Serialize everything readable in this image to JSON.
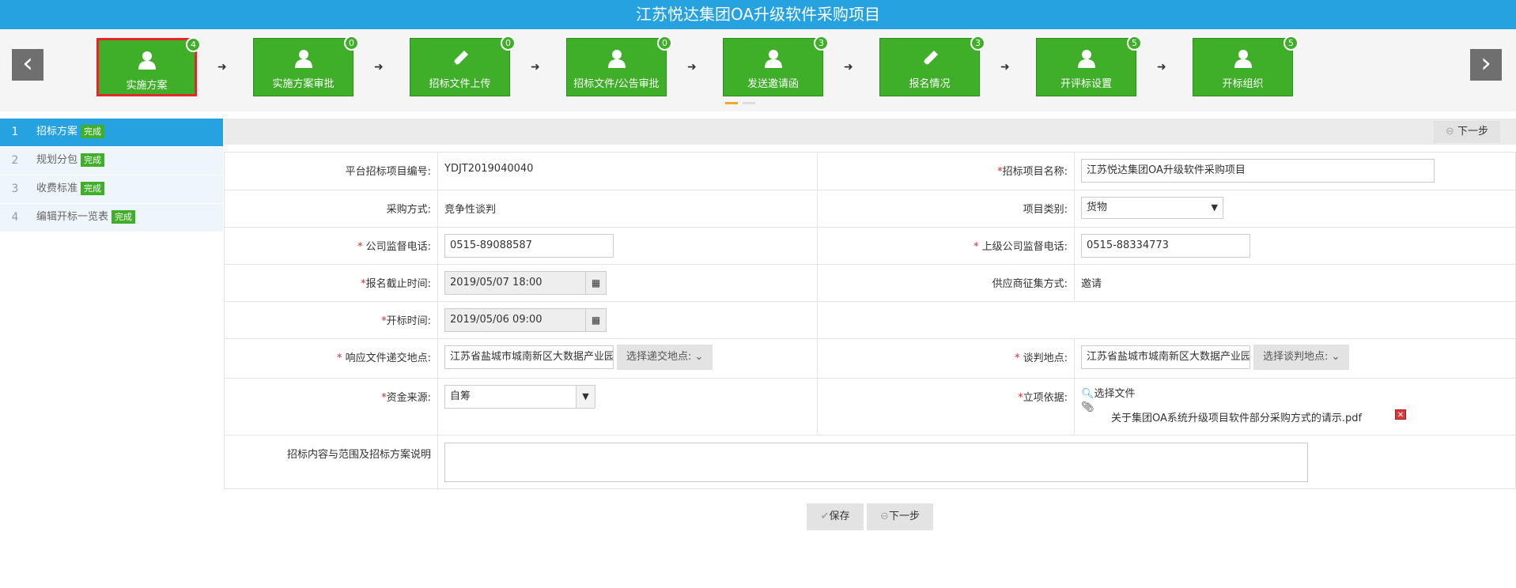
{
  "title": "江苏悦达集团OA升级软件采购项目",
  "steps": [
    {
      "label": "实施方案",
      "count": "4",
      "icon": "user"
    },
    {
      "label": "实施方案审批",
      "count": "0",
      "icon": "user"
    },
    {
      "label": "招标文件上传",
      "count": "0",
      "icon": "pencil"
    },
    {
      "label": "招标文件/公告审批",
      "count": "0",
      "icon": "user"
    },
    {
      "label": "发送邀请函",
      "count": "3",
      "icon": "user"
    },
    {
      "label": "报名情况",
      "count": "3",
      "icon": "pencil"
    },
    {
      "label": "开评标设置",
      "count": "5",
      "icon": "user"
    },
    {
      "label": "开标组织",
      "count": "5",
      "icon": "user"
    }
  ],
  "nav_prev": "‹",
  "nav_next": "›",
  "sidebar": [
    {
      "num": "1",
      "label": "招标方案",
      "status": "完成"
    },
    {
      "num": "2",
      "label": "规划分包",
      "status": "完成"
    },
    {
      "num": "3",
      "label": "收费标准",
      "status": "完成"
    },
    {
      "num": "4",
      "label": "编辑开标一览表",
      "status": "完成"
    }
  ],
  "next_step_label": "下一步",
  "form": {
    "project_no_label": "平台招标项目编号:",
    "project_no": "YDJT2019040040",
    "project_name_label": "招标项目名称:",
    "project_name": "江苏悦达集团OA升级软件采购项目",
    "purchase_method_label": "采购方式:",
    "purchase_method": "竞争性谈判",
    "project_type_label": "项目类别:",
    "project_type": "货物",
    "company_phone_label": "公司监督电话:",
    "company_phone": "0515-89088587",
    "parent_phone_label": "上级公司监督电话:",
    "parent_phone": "0515-88334773",
    "deadline_label": "报名截止时间:",
    "deadline": "2019/05/07 18:00",
    "supplier_method_label": "供应商征集方式:",
    "supplier_method": "邀请",
    "open_time_label": "开标时间:",
    "open_time": "2019/05/06 09:00",
    "submit_place_label": "响应文件递交地点:",
    "submit_place": "江苏省盐城市城南新区大数据产业园",
    "submit_place_btn": "选择递交地点:",
    "negotiation_place_label": "谈判地点:",
    "negotiation_place": "江苏省盐城市城南新区大数据产业园",
    "negotiation_place_btn": "选择谈判地点:",
    "fund_source_label": "资金来源:",
    "fund_source": "自筹",
    "basis_label": "立项依据:",
    "select_file": "选择文件",
    "file_name": "关于集团OA系统升级项目软件部分采购方式的请示.pdf",
    "scope_label": "招标内容与范围及招标方案说明"
  },
  "save_label": "保存",
  "colors": {
    "topbar": "#27a2e0",
    "step": "#3fae29",
    "active_border": "#e5262b",
    "required": "#e5262b"
  }
}
